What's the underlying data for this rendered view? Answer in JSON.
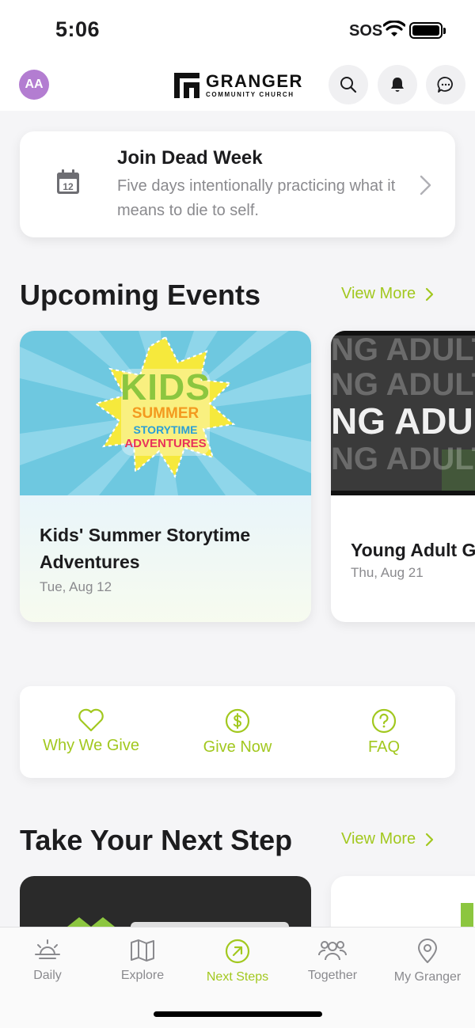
{
  "status_bar": {
    "time": "5:06",
    "carrier": "SOS"
  },
  "header": {
    "avatar_initials": "AA",
    "logo_title": "GRANGER",
    "logo_subtitle": "COMMUNITY CHURCH",
    "icons": [
      "search-icon",
      "bell-icon",
      "chat-icon"
    ]
  },
  "promo": {
    "title": "Join Dead Week",
    "description": "Five days intentionally practicing what it means to die to self.",
    "calendar_day": "12"
  },
  "upcoming_events": {
    "title": "Upcoming Events",
    "view_more": "View More",
    "items": [
      {
        "title": "Kids' Summer Storytime Adventures",
        "date": "Tue, Aug 12",
        "image_text": [
          "KIDS",
          "SUMMER",
          "STORYTIME",
          "ADVENTURES"
        ]
      },
      {
        "title": "Young Adult G",
        "date": "Thu, Aug 21",
        "image_text": "NG ADULTS"
      }
    ]
  },
  "give": {
    "items": [
      {
        "label": "Why We Give",
        "icon": "heart-icon"
      },
      {
        "label": "Give Now",
        "icon": "dollar-icon"
      },
      {
        "label": "FAQ",
        "icon": "question-icon"
      }
    ]
  },
  "next_step": {
    "title": "Take Your Next Step",
    "view_more": "View More"
  },
  "tabs": [
    {
      "label": "Daily",
      "icon": "sunrise-icon",
      "active": false
    },
    {
      "label": "Explore",
      "icon": "map-icon",
      "active": false
    },
    {
      "label": "Next Steps",
      "icon": "arrow-circle-icon",
      "active": true
    },
    {
      "label": "Together",
      "icon": "people-icon",
      "active": false
    },
    {
      "label": "My Granger",
      "icon": "location-pin-icon",
      "active": false
    }
  ],
  "colors": {
    "accent": "#a2c81f",
    "avatar": "#b37dd1",
    "background": "#f5f5f7"
  }
}
